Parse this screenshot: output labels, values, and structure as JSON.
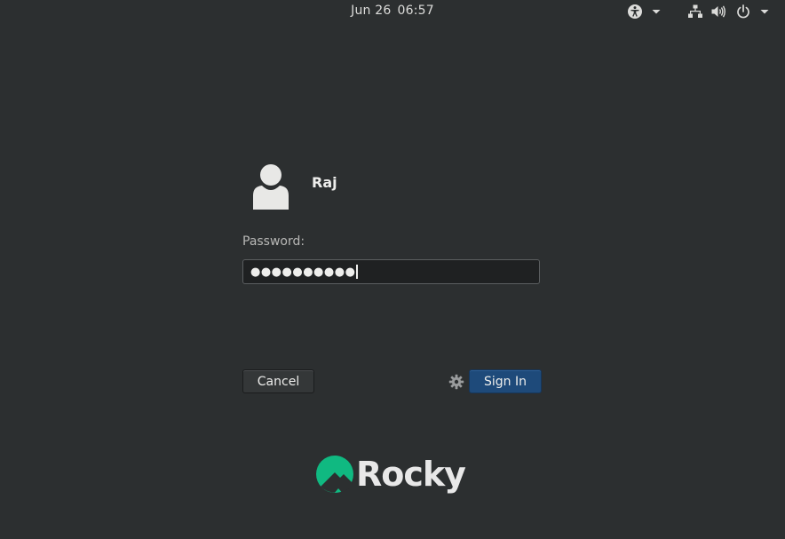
{
  "topbar": {
    "date": "Jun 26",
    "time": "06:57",
    "icons": [
      "accessibility-icon",
      "chevron-down-icon",
      "network-icon",
      "volume-icon",
      "power-icon",
      "chevron-down-icon"
    ]
  },
  "login": {
    "username": "Raj",
    "password_label": "Password:",
    "password_masked": "●●●●●●●●●●",
    "cancel_label": "Cancel",
    "signin_label": "Sign In",
    "settings_icon": "gear-icon"
  },
  "branding": {
    "logo_text": "Rocky",
    "logo_color": "#10b981"
  },
  "colors": {
    "background": "#2c2f30",
    "signin_button": "#1e4a7a"
  }
}
